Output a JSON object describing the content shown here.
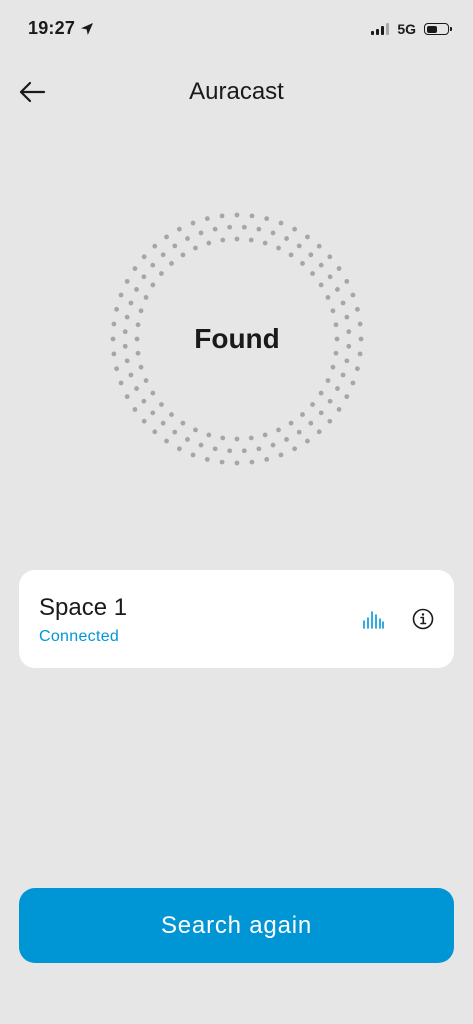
{
  "status_bar": {
    "time": "19:27",
    "network": "5G",
    "icons": [
      "location-arrow-icon",
      "signal-icon",
      "battery-icon"
    ]
  },
  "header": {
    "title": "Auracast",
    "back_icon": "arrow-left-icon"
  },
  "scanner": {
    "status": "Found"
  },
  "device": {
    "name": "Space 1",
    "status": "Connected",
    "stream_icon": "audio-stream-icon",
    "info_icon": "info-icon"
  },
  "actions": {
    "search_again_label": "Search again"
  },
  "colors": {
    "background": "#e6e6e6",
    "accent": "#0096d6",
    "card": "#ffffff",
    "dots": "#a6a6a6"
  }
}
